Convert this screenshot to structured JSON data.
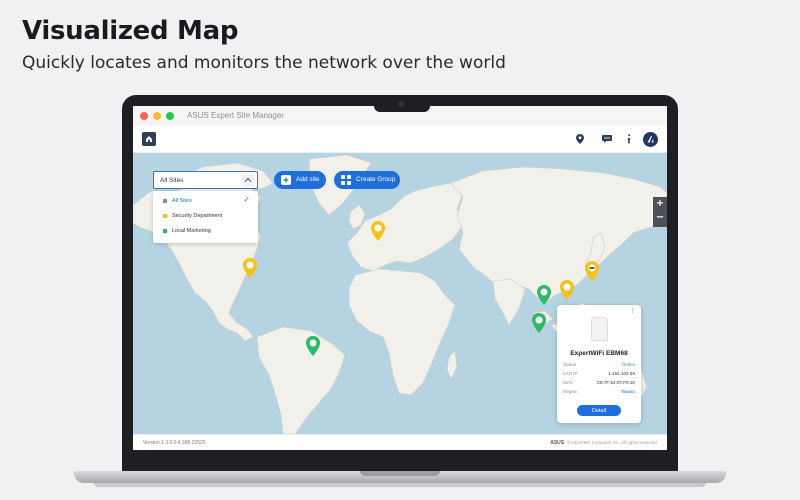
{
  "hero": {
    "title": "Visualized Map",
    "subtitle": "Quickly locates and monitors the network over the world"
  },
  "window": {
    "title": "ASUS Expert Site Manager"
  },
  "toolbar": {
    "icons": [
      "home-icon",
      "location-icon",
      "chat-icon",
      "info-icon",
      "user-avatar"
    ]
  },
  "site_filter": {
    "value": "All Sites",
    "options": [
      {
        "label": "All Sites",
        "color": "#8a8d93",
        "selected": true
      },
      {
        "label": "Security Department",
        "color": "#f2c31a",
        "selected": false
      },
      {
        "label": "Local Marketing",
        "color": "#2fb866",
        "selected": false
      }
    ]
  },
  "actions": {
    "add_site": "Add site",
    "create_group": "Create Group"
  },
  "zoom": {
    "plus": "+",
    "minus": "−"
  },
  "pins": [
    {
      "region": "north-america",
      "color": "#f2c31a"
    },
    {
      "region": "europe",
      "color": "#f2c31a"
    },
    {
      "region": "south-america",
      "color": "#2fb866"
    },
    {
      "region": "south-asia",
      "color": "#2fb866"
    },
    {
      "region": "taiwan",
      "color": "#f2c31a"
    },
    {
      "region": "japan",
      "color": "#f2c31a"
    },
    {
      "region": "southeast-asia",
      "color": "#2fb866"
    }
  ],
  "device_card": {
    "name": "ExpertWiFi EBM68",
    "rows": [
      {
        "label": "Status",
        "value": "Online",
        "tone": "green"
      },
      {
        "label": "LAN IP",
        "value": "1.164.104.56",
        "tone": "normal"
      },
      {
        "label": "MAC",
        "value": "C8:7F:54:07:F0:10",
        "tone": "normal"
      },
      {
        "label": "Region",
        "value": "Taiwan",
        "tone": "blue"
      }
    ],
    "detail_button": "Detail"
  },
  "footer": {
    "version": "Version 1.3.0.0.4.388.23525",
    "brand": "ASUS",
    "copyright": "©ASUSTeK Computer Inc. All rights reserved"
  },
  "colors": {
    "accent": "#1e6fd9",
    "ocean": "#b6d3e1",
    "land": "#f1f0ea",
    "pin_yellow": "#f2c31a",
    "pin_green": "#2fb866"
  }
}
